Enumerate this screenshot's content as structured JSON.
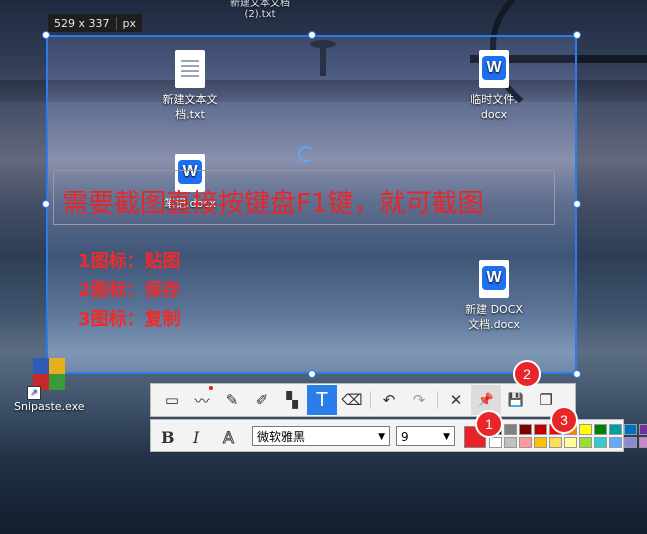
{
  "size_badge": {
    "dims": "529 x 337",
    "unit": "px"
  },
  "desktop": {
    "top_partial_label": "新建文本文档",
    "top_partial_label2": "(2).txt",
    "files": [
      {
        "name1": "新建文本文",
        "name2": "档.txt",
        "type": "txt"
      },
      {
        "name1": "临时文件.",
        "name2": "docx",
        "type": "wps"
      },
      {
        "name1": "笔记.docx",
        "name2": "",
        "type": "wps"
      },
      {
        "name1": "新建 DOCX",
        "name2": "文档.docx",
        "type": "wps"
      }
    ],
    "app_shortcut": "Snipaste.exe"
  },
  "annotation": {
    "headline": "需要截图直接按键盘F1键，就可截图",
    "legend": [
      "1图标：贴图",
      "2图标：保存",
      "3图标：复制"
    ],
    "color": "#ef2b2b"
  },
  "toolbar": {
    "tools": [
      {
        "name": "rectangle-tool",
        "glyph": "▭"
      },
      {
        "name": "line-tool",
        "glyph": "〰"
      },
      {
        "name": "pencil-tool",
        "glyph": "✎"
      },
      {
        "name": "marker-tool",
        "glyph": "✐"
      },
      {
        "name": "mosaic-tool",
        "glyph": "▚"
      },
      {
        "name": "text-tool",
        "glyph": "T"
      },
      {
        "name": "eraser-tool",
        "glyph": "⌫"
      },
      {
        "name": "undo-button",
        "glyph": "↶"
      },
      {
        "name": "redo-button",
        "glyph": "↷"
      },
      {
        "name": "close-button",
        "glyph": "✕"
      },
      {
        "name": "pin-button",
        "glyph": "📌"
      },
      {
        "name": "save-button",
        "glyph": "💾"
      },
      {
        "name": "copy-button",
        "glyph": "❐"
      }
    ],
    "active_tool": "text-tool"
  },
  "format_bar": {
    "bold": "B",
    "italic": "I",
    "outline": "A",
    "font": "微软雅黑",
    "size": "9",
    "current_color": "#e8222a",
    "palette": [
      "#000000",
      "#808080",
      "#800000",
      "#c00000",
      "#ff0000",
      "#ff8000",
      "#ffff00",
      "#008000",
      "#00a0a0",
      "#0070c0",
      "#7030a0",
      "#ffffff",
      "#c0c0c0",
      "#ff9999",
      "#ffc000",
      "#ffdd55",
      "#ffff99",
      "#99dd33",
      "#33cccc",
      "#66aaff",
      "#8888dd",
      "#cc88cc"
    ]
  },
  "badges": [
    "1",
    "2",
    "3"
  ]
}
